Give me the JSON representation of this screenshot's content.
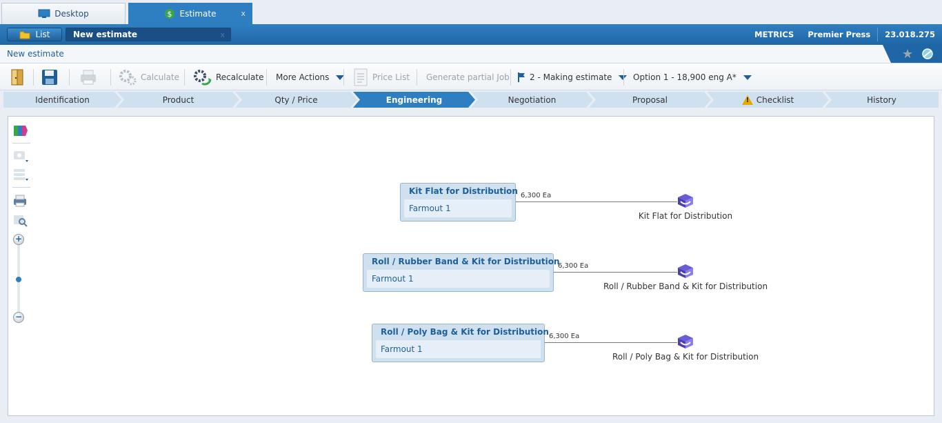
{
  "window_tabs": [
    {
      "label": "Desktop",
      "icon": "monitor-icon"
    },
    {
      "label": "Estimate",
      "icon": "dollar-doc-icon",
      "close": "x"
    }
  ],
  "header": {
    "list_label": "List",
    "record_title": "New estimate",
    "record_close": "x",
    "metrics": "METRICS",
    "company": "Premier Press",
    "version": "23.018.275"
  },
  "breadcrumb": "New estimate",
  "toolbar": {
    "calculate": "Calculate",
    "recalculate": "Recalculate",
    "more_actions": "More Actions",
    "price_list": "Price List",
    "generate_partial_job": "Generate partial Job",
    "status": "2 - Making estimate",
    "option": "Option 1 - 18,900 eng A*"
  },
  "steps": [
    "Identification",
    "Product",
    "Qty / Price",
    "Engineering",
    "Negotiation",
    "Proposal",
    "Checklist",
    "History"
  ],
  "active_step": "Engineering",
  "nodes": [
    {
      "title": "Kit Flat for Distribution",
      "sub": "Farmout 1",
      "qty": "6,300 Ea",
      "output": "Kit Flat for Distribution"
    },
    {
      "title": "Roll / Rubber Band & Kit for Distribution",
      "sub": "Farmout 1",
      "qty": "6,300 Ea",
      "output": "Roll / Rubber Band & Kit for Distribution"
    },
    {
      "title": "Roll / Poly Bag & Kit for Distribution",
      "sub": "Farmout 1",
      "qty": "6,300 Ea",
      "output": "Roll / Poly Bag & Kit for Distribution"
    }
  ],
  "colors": {
    "brand_blue": "#2e7fc2",
    "dark_blue": "#1f66a6",
    "node_fill": "#cfe0ef",
    "warning": "#e6a700"
  }
}
